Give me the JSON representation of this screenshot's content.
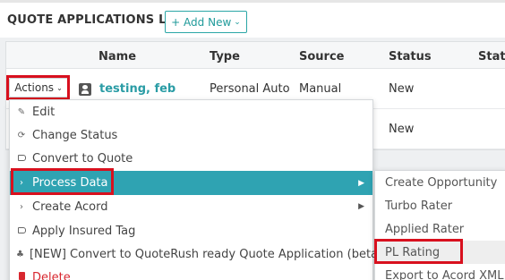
{
  "header": {
    "title": "QUOTE APPLICATIONS LIST",
    "add_new_label": "+ Add New",
    "add_new_chevron": "⌄"
  },
  "table": {
    "columns": [
      "Name",
      "Type",
      "Source",
      "Status",
      "State"
    ],
    "rows": [
      {
        "name": "testing, feb",
        "type": "Personal Auto",
        "source": "Manual",
        "status": "New"
      },
      {
        "name": "",
        "type": "",
        "source": "",
        "status": "New"
      }
    ]
  },
  "actions": {
    "label": "Actions",
    "chevron": "⌄"
  },
  "menu": {
    "items": [
      {
        "label": "Edit",
        "icon": "pencil-icon"
      },
      {
        "label": "Change Status",
        "icon": "refresh-icon"
      },
      {
        "label": "Convert to Quote",
        "icon": "tag-icon"
      },
      {
        "label": "Process Data",
        "icon": "chevron-right-icon",
        "active": true,
        "has_submenu": true
      },
      {
        "label": "Create Acord",
        "icon": "chevron-right-icon",
        "has_submenu": true
      },
      {
        "label": "Apply Insured Tag",
        "icon": "tag-icon"
      },
      {
        "label": "[NEW] Convert to QuoteRush ready Quote Application (beta)",
        "icon": "cubes-icon"
      },
      {
        "label": "Delete",
        "icon": "trash-icon",
        "danger": true
      }
    ]
  },
  "submenu": {
    "items": [
      {
        "label": "Create Opportunity"
      },
      {
        "label": "Turbo Rater"
      },
      {
        "label": "Applied Rater"
      },
      {
        "label": "PL Rating",
        "hover": true
      },
      {
        "label": "Export to Acord XML"
      }
    ]
  },
  "colors": {
    "accent": "#2fa3b2",
    "highlight_box": "#d8101e",
    "link": "#2a9ca5",
    "danger": "#d8272f"
  }
}
